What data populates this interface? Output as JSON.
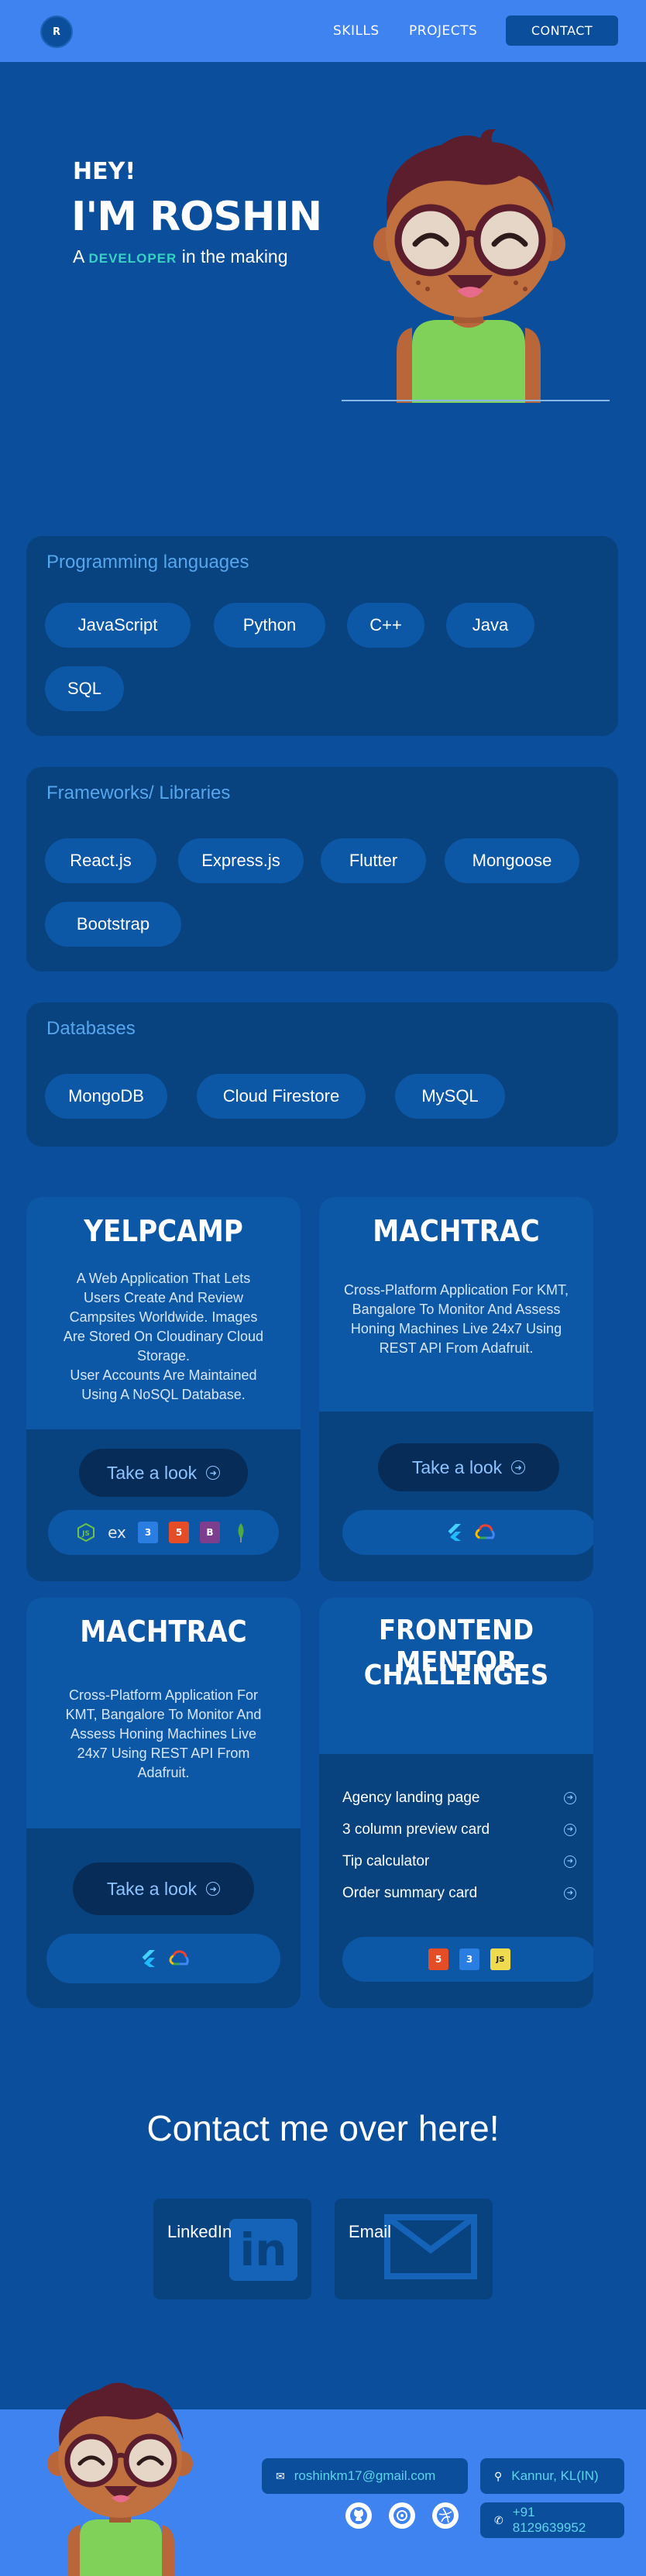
{
  "nav": {
    "logo": "R",
    "skills": "SKILLS",
    "projects": "PROJECTS",
    "contact": "CONTACT"
  },
  "hero": {
    "hey": "HEY!",
    "name": "I'M ROSHIN",
    "sub_prefix": "A",
    "sub_highlight": "DEVELOPER",
    "sub_suffix": "in the making"
  },
  "skills": {
    "languages": {
      "title": "Programming languages",
      "items": [
        "JavaScript",
        "Python",
        "C++",
        "Java",
        "SQL"
      ]
    },
    "frameworks": {
      "title": "Frameworks/ Libraries",
      "items": [
        "React.js",
        "Express.js",
        "Flutter",
        "Mongoose",
        "Bootstrap"
      ]
    },
    "databases": {
      "title": "Databases",
      "items": [
        "MongoDB",
        "Cloud Firestore",
        "MySQL"
      ]
    }
  },
  "projects": [
    {
      "title": "YELPCAMP",
      "desc": [
        "A Web Application That Lets",
        "Users Create And Review",
        "Campsites Worldwide. Images",
        "Are Stored On Cloudinary Cloud",
        "Storage.",
        "User Accounts Are Maintained",
        "Using A NoSQL Database."
      ],
      "button": "Take a look",
      "tech": [
        "nodejs-icon",
        "express-icon",
        "css3-icon",
        "html5-icon",
        "bootstrap-icon",
        "mongodb-icon"
      ]
    },
    {
      "title": "MACHTRAC",
      "desc": [
        "Cross-Platform Application For KMT,",
        "Bangalore To Monitor And Assess",
        "Honing Machines Live 24x7 Using",
        "REST API From Adafruit."
      ],
      "button": "Take a look",
      "tech": [
        "flutter-icon",
        "google-cloud-icon"
      ]
    },
    {
      "title": "MACHTRAC",
      "desc": [
        "Cross-Platform Application For",
        "KMT, Bangalore To Monitor And",
        "Assess Honing Machines Live",
        "24x7 Using REST API From",
        "Adafruit."
      ],
      "button": "Take a look",
      "tech": [
        "flutter-icon",
        "google-cloud-icon"
      ]
    },
    {
      "title_line1": "FRONTEND MENTOR",
      "title_line2": "CHALLENGES",
      "items": [
        "Agency landing page",
        "3 column preview card",
        "Tip calculator",
        "Order summary card"
      ],
      "tech": [
        "html5-icon",
        "css3-icon",
        "javascript-icon"
      ]
    }
  ],
  "tech_labels": {
    "express": "ex",
    "html5": "5",
    "css3": "3",
    "bootstrap": "B",
    "js": "JS"
  },
  "contact": {
    "title": "Contact me over here!",
    "linkedin": "LinkedIn",
    "email": "Email",
    "linkedin_logo": "in"
  },
  "footer": {
    "email": "roshinkm17@gmail.com",
    "location": "Kannur, KL(IN)",
    "phone": "+91 8129639952"
  },
  "colors": {
    "background": "#0b4f9c",
    "nav": "#3f83f0",
    "card": "#08427f",
    "pill": "#0c57a6",
    "accent": "#36d2c3",
    "title_accent": "#56a6ee"
  }
}
